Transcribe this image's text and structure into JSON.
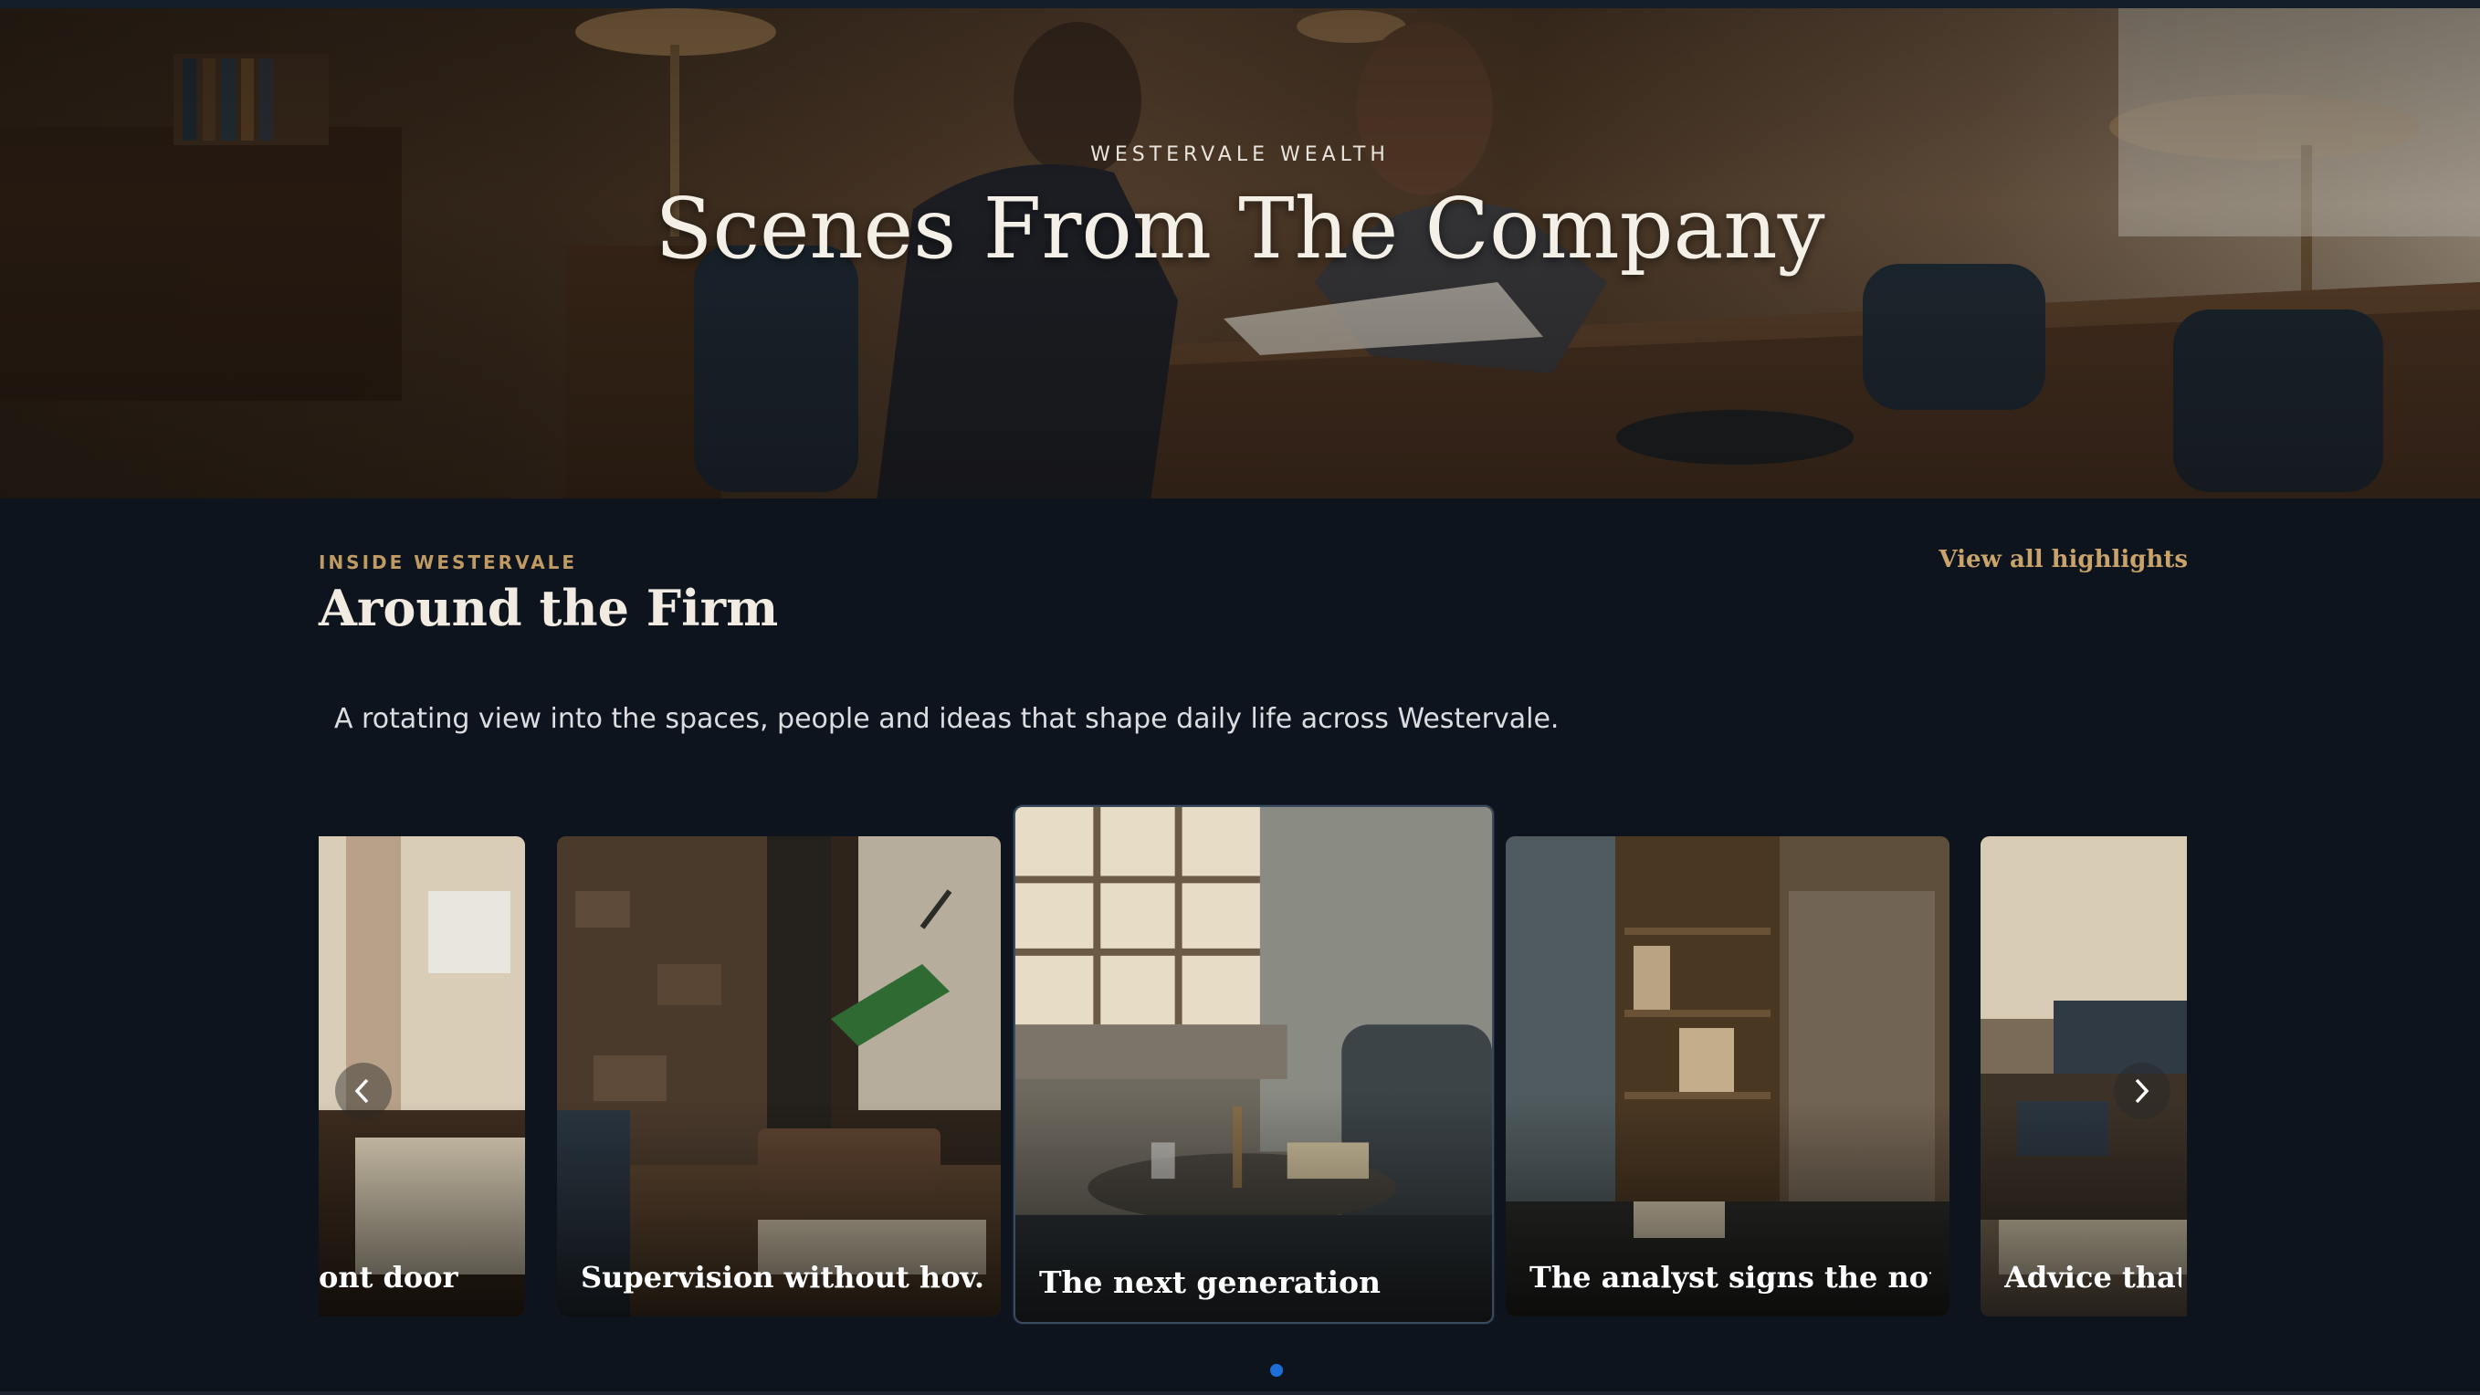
{
  "hero": {
    "eyebrow": "WESTERVALE WEALTH",
    "title": "Scenes From The Company"
  },
  "section": {
    "eyebrow": "INSIDE WESTERVALE",
    "title": "Around the Firm",
    "view_all_label": "View all highlights",
    "description": "A rotating view into the spaces, people and ideas that shape daily life across Westervale."
  },
  "carousel": {
    "cards": [
      {
        "title": "ont door"
      },
      {
        "title": "Supervision without hov..."
      },
      {
        "title": "The next generation"
      },
      {
        "title": "The analyst signs the note"
      },
      {
        "title": "Advice that l"
      }
    ],
    "prev_icon": "chevron-left-icon",
    "next_icon": "chevron-right-icon",
    "pagination_count": 1,
    "active_dot_color": "#1d6fd8"
  },
  "colors": {
    "background": "#0d141d",
    "accent_gold": "#c9a36a",
    "eyebrow_gold": "#bf9a62"
  }
}
